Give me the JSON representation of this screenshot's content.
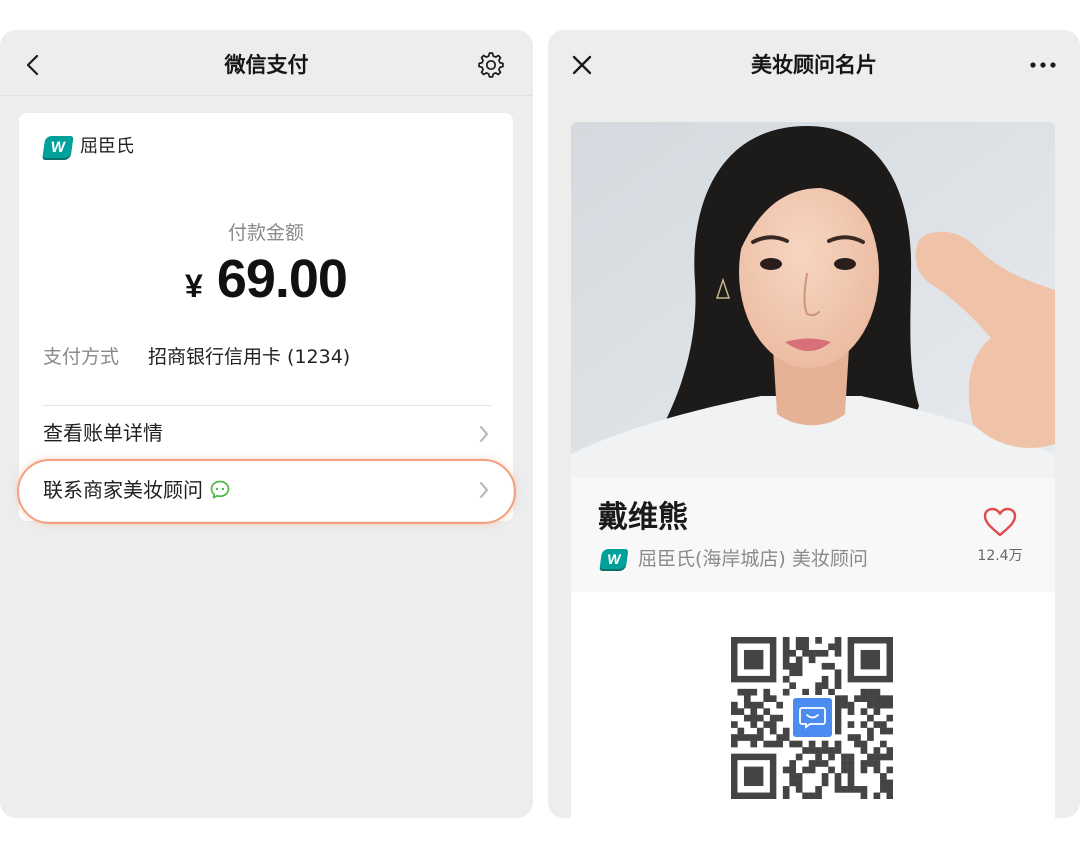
{
  "brand": {
    "logo_letter": "W"
  },
  "left": {
    "header": {
      "title": "微信支付",
      "icons": [
        "chevron-left-icon",
        "gear-icon"
      ]
    },
    "merchant": {
      "name": "屈臣氏"
    },
    "amount": {
      "label": "付款金额",
      "currency": "¥",
      "value": "69.00"
    },
    "payment": {
      "label": "支付方式",
      "method": "招商银行信用卡 (1234)"
    },
    "rows": [
      {
        "label": "查看账单详情",
        "icon": "chevron-right-icon"
      },
      {
        "label": "联系商家美妆顾问",
        "icon": "chat-bubble-icon",
        "highlighted": true
      }
    ]
  },
  "right": {
    "header": {
      "title": "美妆顾问名片",
      "icons": [
        "close-icon",
        "more-icon"
      ]
    },
    "profile": {
      "name": "戴维熊",
      "store": "屈臣氏(海岸城店) 美妆顾问",
      "likes": "12.4万",
      "icons": [
        "heart-icon",
        "qr-code-icon"
      ]
    }
  },
  "colors": {
    "highlight": "#f2a07e",
    "wechat_green": "#4fb946",
    "heart": "#e24b4b",
    "qr_center": "#4a8cf0",
    "panel_bg": "#ededed",
    "brand": "#00a19a"
  }
}
